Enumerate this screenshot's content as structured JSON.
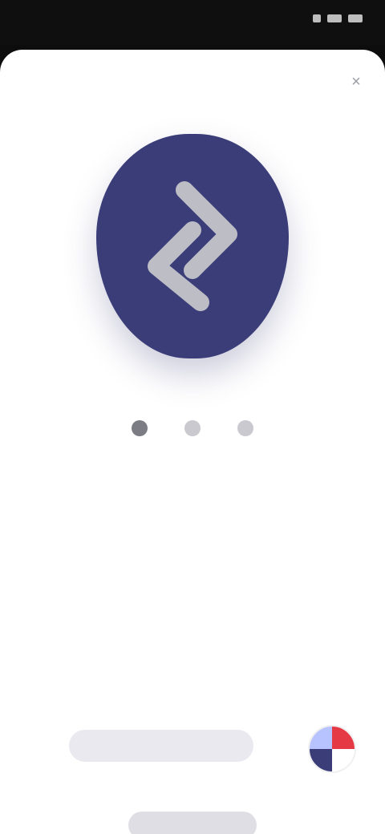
{
  "status_bar": {
    "time": "",
    "icons": [
      "signal-icon",
      "wifi-icon",
      "battery-icon"
    ]
  },
  "sheet": {
    "title": "",
    "close_label": "×"
  },
  "hero": {
    "icon": "swap-arrows-icon",
    "badge_color": "#3a3d78",
    "icon_color": "#bdbdc6"
  },
  "pager": {
    "count": 3,
    "active_index": 0
  },
  "details": {
    "kicker": "",
    "value": ""
  },
  "section": {
    "title": "",
    "paragraph": ""
  },
  "actions": {
    "primary_label": "",
    "secondary_label": ""
  }
}
